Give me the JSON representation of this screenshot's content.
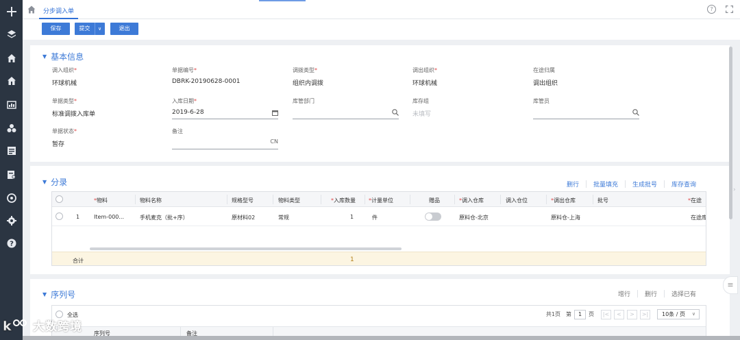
{
  "rail": {
    "icons": [
      "plus-icon",
      "layers-icon",
      "home-icon",
      "home-alt-icon",
      "chart-icon",
      "group-icon",
      "list-icon",
      "report-icon",
      "target-icon",
      "settings-icon",
      "help-icon"
    ]
  },
  "tabbar": {
    "tab_label": "分步调入单",
    "help_glyph": "?"
  },
  "toolbar": {
    "save_label": "保存",
    "submit_label": "提交",
    "submit_caret": "∨",
    "exit_label": "退出"
  },
  "basic_info": {
    "title": "基本信息",
    "fields": [
      {
        "label": "调入组织",
        "required": true,
        "value": "环球机械"
      },
      {
        "label": "单据编号",
        "required": true,
        "value": "DBRK-20190628-0001"
      },
      {
        "label": "调拨类型",
        "required": true,
        "value": "组织内调拨"
      },
      {
        "label": "调出组织",
        "required": true,
        "value": "环球机械"
      },
      {
        "label": "在途归属",
        "required": false,
        "value": "调出组织"
      },
      {
        "label": "单据类型",
        "required": true,
        "value": "标准调拨入库单"
      },
      {
        "label": "入库日期",
        "required": true,
        "value": "2019-6-28"
      },
      {
        "label": "库管部门",
        "required": false,
        "value": ""
      },
      {
        "label": "库存组",
        "required": false,
        "value": "",
        "placeholder": "未填写"
      },
      {
        "label": "库管员",
        "required": false,
        "value": ""
      },
      {
        "label": "单据状态",
        "required": true,
        "value": "暂存"
      },
      {
        "label": "备注",
        "required": false,
        "value": "",
        "suffix": "CN"
      }
    ],
    "required_mark": "*"
  },
  "entries": {
    "title": "分录",
    "actions": [
      "删行",
      "批量填充",
      "生成批号",
      "库存查询"
    ],
    "columns": [
      {
        "label": "物料",
        "required": true
      },
      {
        "label": "物料名称",
        "required": false
      },
      {
        "label": "规格型号",
        "required": false
      },
      {
        "label": "物料类型",
        "required": false
      },
      {
        "label": "入库数量",
        "required": true
      },
      {
        "label": "计量单位",
        "required": true
      },
      {
        "label": "赠品",
        "required": false
      },
      {
        "label": "调入仓库",
        "required": true
      },
      {
        "label": "调入仓位",
        "required": false
      },
      {
        "label": "调出仓库",
        "required": true
      },
      {
        "label": "批号",
        "required": false
      },
      {
        "label": "在途",
        "required": true
      }
    ],
    "rows": [
      {
        "seq": "1",
        "material": "Item-000...",
        "name": "手机麦克（批+序）",
        "spec": "原材料02",
        "type": "常规",
        "qty": "1",
        "unit": "件",
        "gift": false,
        "in_wh": "原料仓-北京",
        "in_loc": "",
        "out_wh": "原料仓-上海",
        "batch": "",
        "transit": "在途库"
      }
    ],
    "total_label": "合计",
    "total_qty": "1"
  },
  "serial": {
    "title": "序列号",
    "actions": [
      "增行",
      "删行",
      "选择已有"
    ],
    "select_all": "全选",
    "pager": {
      "total": "共1页",
      "page_prefix": "第",
      "page": "1",
      "page_suffix": "页",
      "page_size": "10条 / 页"
    },
    "columns": [
      "序列号",
      "备注"
    ]
  },
  "watermark": "大数跨境",
  "colors": {
    "primary": "#3d7ad7",
    "rail": "#2b3542",
    "required": "#e04848",
    "total_row": "#fcf5e2"
  }
}
